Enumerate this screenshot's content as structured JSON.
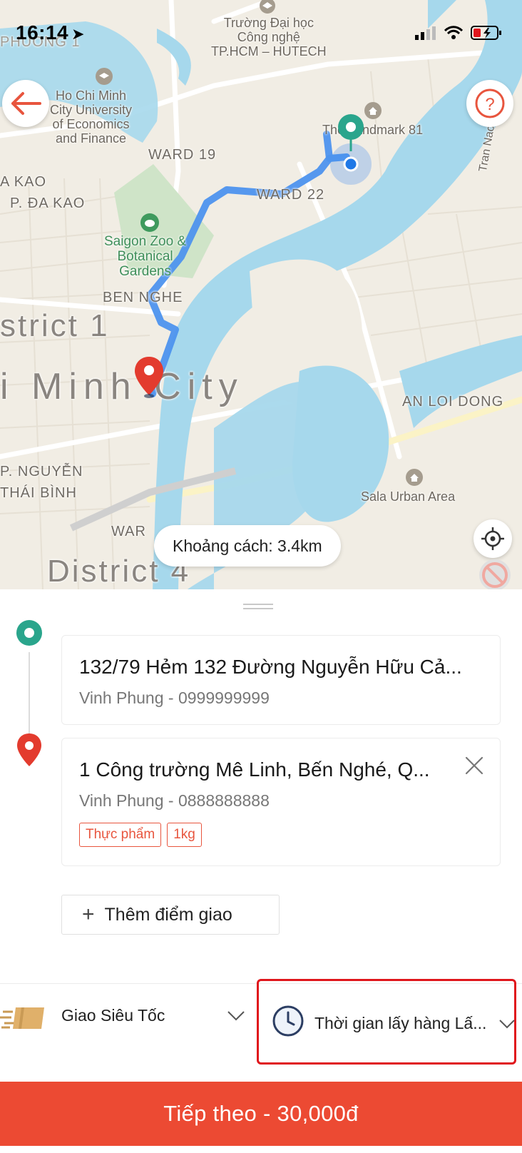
{
  "status_bar": {
    "time": "16:14"
  },
  "map": {
    "labels": {
      "top_poi": "Trường Đại học\nCông nghệ\nTP.HCM – HUTECH",
      "phuong": "PHUONG 1",
      "university": "Ho Chi Minh\nCity University\nof Economics\nand Finance",
      "ward19": "WARD 19",
      "a_kao": "A KAO",
      "p_da_kao": "P. ĐA KAO",
      "ward22": "WARD 22",
      "landmark": "The Landmark 81",
      "tran_nao": "Tran Nao",
      "zoo": "Saigon Zoo &\nBotanical\nGardens",
      "ben_nghe": "BEN NGHE",
      "district1": "strict 1",
      "city": "i Minh City",
      "an_loi_dong": "AN LOI DONG",
      "p_nguyen_thai_binh": "P. NGUYỄN\nTHÁI BÌNH",
      "sala": "Sala Urban Area",
      "ward_bottom": "WAR",
      "district4": "District 4"
    },
    "distance_pill": "Khoảng cách: 3.4km"
  },
  "stops": {
    "pickup": {
      "address": "132/79 Hẻm 132 Đường Nguyễn Hữu Cả...",
      "contact": "Vinh Phung - 0999999999"
    },
    "dropoff": {
      "address": "1 Công trường Mê Linh, Bến Nghé, Q...",
      "contact": "Vinh Phung - 0888888888",
      "tags": [
        "Thực phẩm",
        "1kg"
      ]
    }
  },
  "add_stop_label": "Thêm điểm giao",
  "service": {
    "selected": "Giao Siêu Tốc"
  },
  "pickup_time": {
    "selected": "Thời gian lấy hàng Lấ..."
  },
  "next_button": "Tiếp theo - 30,000đ",
  "colors": {
    "accent_red": "#ec4a33",
    "pickup_green": "#2aa58c",
    "route_blue": "#4d94ee",
    "river": "#a6d8ec",
    "highlight_box": "#e0161c"
  }
}
